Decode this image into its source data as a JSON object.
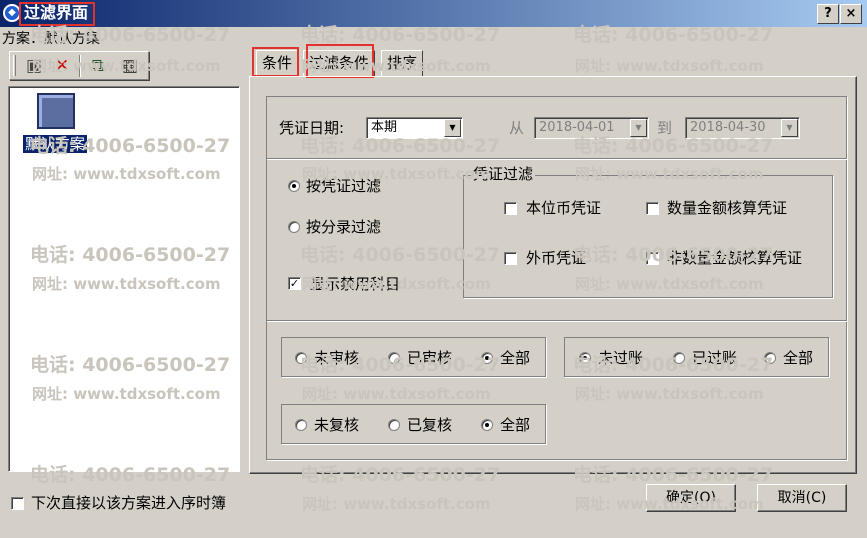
{
  "window": {
    "title": "过滤界面",
    "help_glyph": "?",
    "close_glyph": "×",
    "title_glyph": "◆"
  },
  "scheme": {
    "label": "方案：默认方案"
  },
  "toolbar": [
    {
      "name": "save-icon",
      "glyph": "▣"
    },
    {
      "name": "delete-icon",
      "glyph": "✕"
    },
    {
      "name": "copy-icon",
      "glyph": "⧉"
    },
    {
      "name": "table-icon",
      "glyph": "▦"
    }
  ],
  "scheme_list": {
    "items": [
      {
        "label": "默认方案",
        "selected": true
      }
    ]
  },
  "tabs": [
    {
      "label": "条件",
      "active": true
    },
    {
      "label": "过滤条件",
      "active": false
    },
    {
      "label": "排序",
      "active": false
    }
  ],
  "date": {
    "label": "凭证日期:",
    "period": "本期",
    "from_label": "从",
    "from": "2018-04-01",
    "to_label": "到",
    "to": "2018-04-30"
  },
  "filter_mode": {
    "by_voucher": "按凭证过滤",
    "by_entry": "按分录过滤",
    "selected": "by_voucher",
    "show_disabled": "显示禁用科目",
    "show_disabled_checked": true
  },
  "voucher_filter": {
    "legend": "凭证过滤",
    "items": [
      {
        "label": "本位币凭证",
        "checked": false
      },
      {
        "label": "数量金额核算凭证",
        "checked": false
      },
      {
        "label": "外币凭证",
        "checked": false
      },
      {
        "label": "非数量金额核算凭证",
        "checked": false
      }
    ]
  },
  "audit": {
    "options": [
      "未审核",
      "已审核",
      "全部"
    ],
    "selected": 2
  },
  "posting": {
    "options": [
      "未过账",
      "已过账",
      "全部"
    ],
    "selected": 0
  },
  "review": {
    "options": [
      "未复核",
      "已复核",
      "全部"
    ],
    "selected": 2
  },
  "footer": {
    "direct_enter": "下次直接以该方案进入序时簿",
    "direct_enter_checked": false,
    "ok": "确定(O)",
    "cancel": "取消(C)"
  },
  "watermark": {
    "phone": "电话: 4006-6500-27",
    "site": "网址: www.tdxsoft.com"
  },
  "colors": {
    "highlight": "#e2322e",
    "selection": "#0a246a",
    "face": "#d4d0c8"
  }
}
